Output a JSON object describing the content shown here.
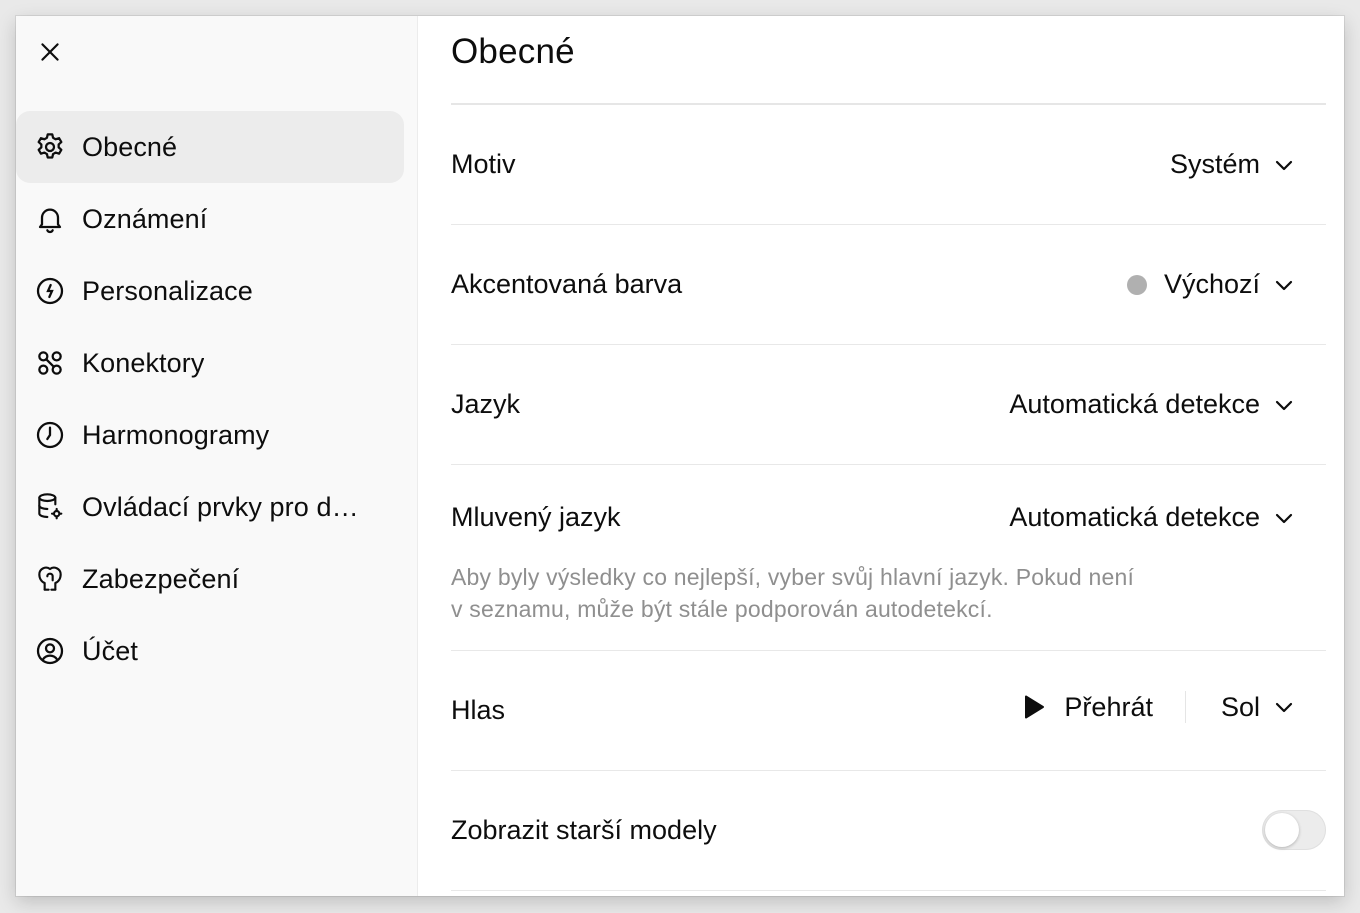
{
  "sidebar": {
    "close_label": "Close",
    "items": [
      {
        "label": "Obecné",
        "icon": "gear-icon",
        "active": true
      },
      {
        "label": "Oznámení",
        "icon": "bell-icon"
      },
      {
        "label": "Personalizace",
        "icon": "personalize-icon"
      },
      {
        "label": "Konektory",
        "icon": "connectors-icon"
      },
      {
        "label": "Harmonogramy",
        "icon": "clock-icon"
      },
      {
        "label": "Ovládací prvky pro d…",
        "icon": "data-controls-icon"
      },
      {
        "label": "Zabezpečení",
        "icon": "security-icon"
      },
      {
        "label": "Účet",
        "icon": "account-icon"
      }
    ]
  },
  "main": {
    "title": "Obecné",
    "settings": {
      "theme": {
        "label": "Motiv",
        "value": "Systém"
      },
      "accent": {
        "label": "Akcentovaná barva",
        "value": "Výchozí",
        "dot_color": "#b0b0b0"
      },
      "language": {
        "label": "Jazyk",
        "value": "Automatická detekce"
      },
      "spoken_language": {
        "label": "Mluvený jazyk",
        "value": "Automatická detekce",
        "description_line1": "Aby byly výsledky co nejlepší, vyber svůj hlavní jazyk. Pokud není",
        "description_line2": "v seznamu, může být stále podporován autodetekcí."
      },
      "voice": {
        "label": "Hlas",
        "play_label": "Přehrát",
        "value": "Sol"
      },
      "legacy_models": {
        "label": "Zobrazit starší modely",
        "enabled": false
      }
    }
  }
}
